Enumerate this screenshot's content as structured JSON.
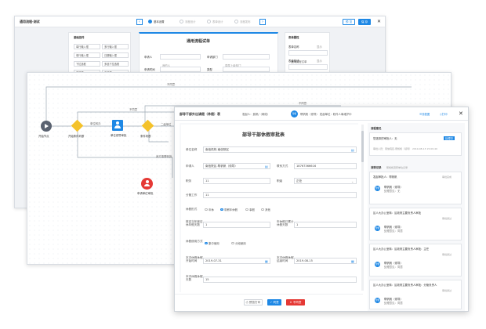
{
  "win1": {
    "title": "通用流程-测试",
    "steps": [
      "基本设置",
      "流程设计",
      "表单设计",
      "流程发布"
    ],
    "btn_preview": "预 览",
    "btn_save": "保 存",
    "close": "✕",
    "controls_title": "基础控件",
    "controls": [
      "单行输入框",
      "多行输入框",
      "单行输入框",
      "日期输入框",
      "下拉选框",
      "多选下拉选框",
      "单选框",
      "多选框"
    ],
    "form_title": "通用流程试单",
    "fields": [
      {
        "label": "申请人",
        "value": "我的人",
        "label2": "申请部门",
        "value2": "直属上级部门"
      },
      {
        "label": "申请时间",
        "value": "年-月-日",
        "label2": "类型",
        "value2": ""
      }
    ],
    "props_title": "表单属性",
    "props": [
      {
        "label": "表单名称",
        "value": "通用流程试单",
        "extra": "显示"
      },
      {
        "label": "表单描述",
        "value": "通用流程试单",
        "extra": "显示"
      }
    ]
  },
  "win2": {
    "edge_labels": [
      "不同意",
      "不同意",
      "不同意",
      "单位转办",
      "二级单位",
      "我方事需转批"
    ],
    "nodes": {
      "start": "开始节点",
      "cond1": "开始条件判断",
      "user": "单位领导审批",
      "cond2": "条件判断",
      "end": "申请单位审批"
    }
  },
  "win3": {
    "title": "部导干部外出请假（休假）表",
    "tag": "发起人：费帆/（网络）",
    "sub": "帮帆帆（领导） 发起单位：软件人事维护中",
    "btn_flow": "流程图",
    "btn_print": "打印",
    "close": "✕",
    "form_title": "部导干部休假审批表",
    "form": {
      "unit_label": "单位名称",
      "unit_value": "南信机构-南信院区",
      "applicant_label": "申请人",
      "applicant_value": "南信院区-帮帆帆（领导）",
      "phone_label": "联系方式",
      "phone_value": "18767366616",
      "post_label": "职务",
      "post_value": "11",
      "rank_label": "职级",
      "rank_value": "正处",
      "unit2_label": "分管工作",
      "unit2_value": "11",
      "leave_type_label": "休假形式",
      "leave_types": [
        "年休",
        "带薪年休假",
        "事假",
        "其他"
      ],
      "leave_type_selected": "带薪年休假",
      "days_label": "核定当年度应休年假天数",
      "days_value": "1",
      "used_label": "年休假已累计休假天数",
      "used_value": "1",
      "use_label": "休假使用方式",
      "use_options": [
        "集中使用",
        "分段使用"
      ],
      "use_selected": "集中使用",
      "start_label": "本次休假休假开始时间",
      "start_value": "2019-07-31",
      "end_label": "本次休假休假结束时间",
      "end_value": "2019-08-15",
      "total_label": "本次休假休假天数",
      "total_value": "15"
    },
    "footer": {
      "print": "预览打印",
      "agree": "同意",
      "reject": "不同意"
    },
    "side": {
      "opinion_title": "流程意见",
      "opinion_card_title": "您选择的审批人：无",
      "opinion_card_btn": "处理中",
      "opinion_line": "审批人员：南信院区-帮帆帆（领导） 2019-08-13 15:09:40",
      "records_title": "流转记录",
      "records_sub": "帮帆帆流转单位记录",
      "records": [
        {
          "head": "发起审批人：帮帆帆",
          "status": "审批完成",
          "name": "帮帆帆（领导）",
          "opinion": "处理意见：无"
        },
        {
          "head": "区人大办公室转：区政府主要负责人审批",
          "status": "审批通过",
          "name": "帮帆帆（领导）",
          "opinion": "处理意见：同意"
        },
        {
          "head": "区人大办公室转：区政府主要负责人审批：主任",
          "status": "审批通过",
          "name": "帮帆帆（领导）",
          "opinion": "处理意见：同意"
        },
        {
          "head": "区人大办公室转：区政府主要负责人审批：分管负责人",
          "status": "审批通过",
          "name": "帮帆帆（领导）",
          "opinion": "处理意见：同意"
        }
      ]
    }
  }
}
